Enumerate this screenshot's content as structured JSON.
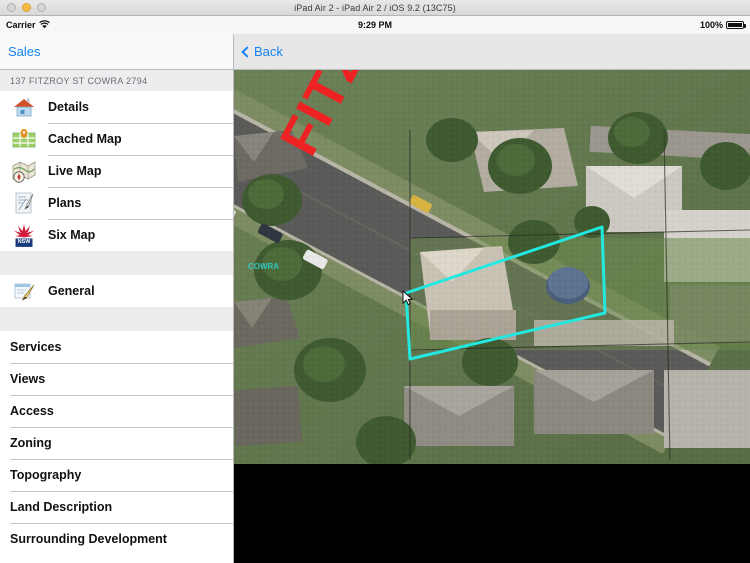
{
  "window": {
    "title": "iPad Air 2 - iPad Air 2 / iOS 9.2 (13C75)",
    "traffic_lights": [
      "close-button",
      "minimize-button",
      "zoom-button"
    ]
  },
  "status_bar": {
    "carrier": "Carrier",
    "wifi_icon": "wifi-icon",
    "time": "9:29 PM",
    "battery_percent": "100%",
    "battery_icon": "battery-full-icon"
  },
  "master": {
    "back_label": "Sales",
    "address_header": "137 FITZROY ST COWRA 2794",
    "primary_items": [
      {
        "label": "Details",
        "icon": "house-icon"
      },
      {
        "label": "Cached Map",
        "icon": "map-pin-icon"
      },
      {
        "label": "Live Map",
        "icon": "folded-map-compass-icon"
      },
      {
        "label": "Plans",
        "icon": "blueprint-pen-icon"
      },
      {
        "label": "Six Map",
        "icon": "nsw-government-waratah-icon"
      }
    ],
    "general_items": [
      {
        "label": "General",
        "icon": "note-pen-icon"
      }
    ],
    "detail_items": [
      {
        "label": "Services"
      },
      {
        "label": "Views"
      },
      {
        "label": "Access"
      },
      {
        "label": "Zoning"
      },
      {
        "label": "Topography"
      },
      {
        "label": "Land Description"
      },
      {
        "label": "Surrounding Development"
      }
    ]
  },
  "detail": {
    "back_label": "Back",
    "street_label": "FITZROY ST",
    "map_attribution": "COWRA",
    "parcel_boundary_color": "#22e8e0",
    "street_label_color": "#ee2222",
    "accent_color": "#1482f0"
  }
}
